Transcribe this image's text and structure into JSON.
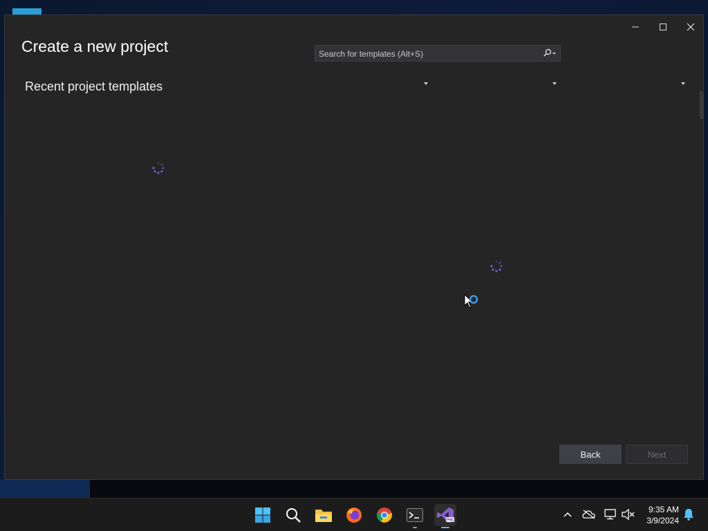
{
  "window": {
    "title": "Create a new project",
    "subtitle": "Recent project templates",
    "controls": {
      "minimize": "minimize-icon",
      "maximize": "maximize-icon",
      "close": "close-icon"
    }
  },
  "search": {
    "placeholder": "Search for templates (Alt+S)",
    "value": "",
    "icon": "search-icon"
  },
  "filters": [
    {
      "label": ""
    },
    {
      "label": ""
    },
    {
      "label": ""
    }
  ],
  "buttons": {
    "back": "Back",
    "next": "Next"
  },
  "loading": {
    "spinner_color": "#6b5fd1"
  },
  "taskbar": {
    "apps": [
      {
        "name": "start-icon"
      },
      {
        "name": "search-icon"
      },
      {
        "name": "file-explorer-icon"
      },
      {
        "name": "firefox-icon"
      },
      {
        "name": "chrome-icon"
      },
      {
        "name": "terminal-icon"
      },
      {
        "name": "visual-studio-icon",
        "badge": "PRE",
        "active": true
      }
    ],
    "tray": [
      "chevron-up-icon",
      "onedrive-offline-icon",
      "network-icon",
      "volume-mute-icon"
    ],
    "clock": {
      "time": "9:35 AM",
      "date": "3/9/2024"
    },
    "notification": "bell-icon"
  },
  "colors": {
    "dialog_bg": "#252526",
    "accent": "#4cc2ff",
    "vs_purple": "#8661c5"
  }
}
